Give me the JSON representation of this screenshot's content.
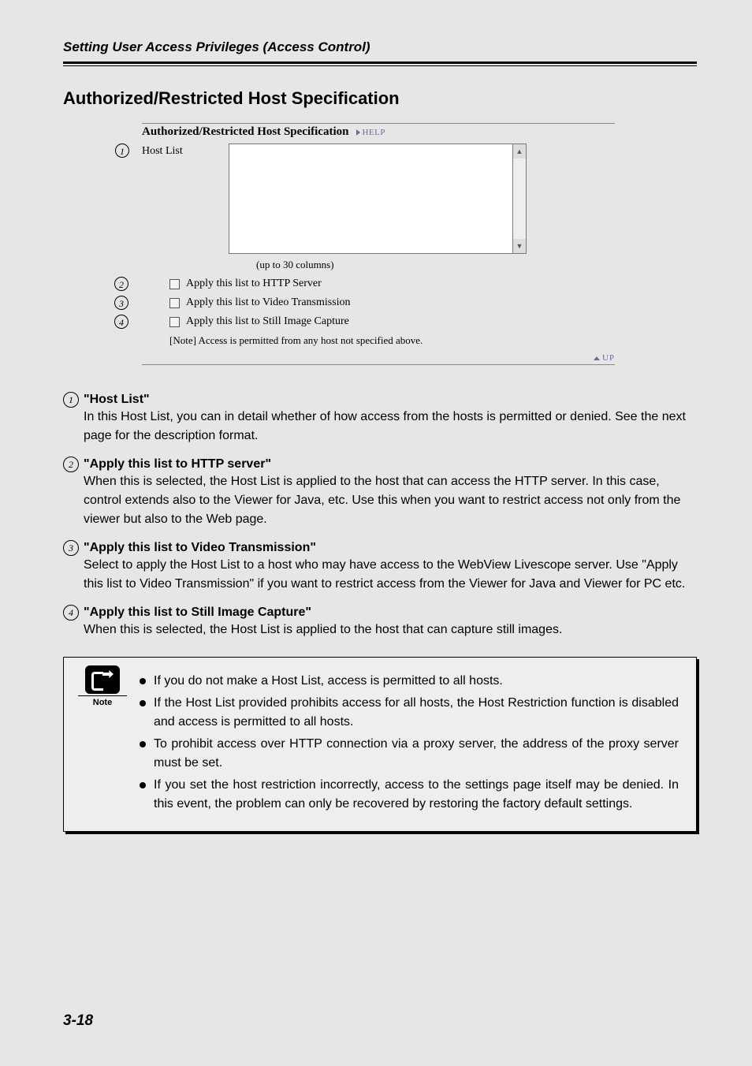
{
  "header": {
    "running_head": "Setting User Access Privileges (Access Control)"
  },
  "section_title": "Authorized/Restricted Host Specification",
  "panel": {
    "title": "Authorized/Restricted Host Specification",
    "help_label": "HELP",
    "up_label": "UP",
    "host_list_label": "Host List",
    "host_list_hint": "(up to 30 columns)",
    "host_list_value": "",
    "checkboxes": [
      {
        "label": "Apply this list to HTTP Server",
        "checked": false
      },
      {
        "label": "Apply this list to Video Transmission",
        "checked": false
      },
      {
        "label": "Apply this list to Still Image Capture",
        "checked": false
      }
    ],
    "note_inline": "[Note] Access is permitted from any host not specified above."
  },
  "definitions": [
    {
      "num": "1",
      "title": "\"Host List\"",
      "body": "In this Host List, you can in detail whether of how access from the hosts is permitted or denied. See the next page for the description format."
    },
    {
      "num": "2",
      "title": "\"Apply this list to HTTP server\"",
      "body": "When this is selected, the Host List is applied to the host that can access the HTTP server. In this case, control extends also to the Viewer for Java, etc. Use this when you want to restrict access not only from the viewer but also to the Web page."
    },
    {
      "num": "3",
      "title": "\"Apply this list to Video Transmission\"",
      "body": "Select to apply the Host List to a host who may have access to the WebView Livescope server. Use \"Apply this list to Video Transmission\" if you want to restrict access from the Viewer for Java and Viewer for PC etc."
    },
    {
      "num": "4",
      "title": "\"Apply this list to Still Image Capture\"",
      "body": "When this is selected, the Host List is applied to the host that can capture still images."
    }
  ],
  "note_box": {
    "label": "Note",
    "items": [
      "If you do not make a Host List, access is permitted to all hosts.",
      "If the Host List provided prohibits access for all hosts, the Host Restriction function is disabled and access is permitted to all hosts.",
      "To prohibit access over HTTP connection via a proxy server, the address of the proxy server must be set.",
      "If you set the host restriction incorrectly, access to the settings page itself may be denied. In this event, the problem can only be recovered by restoring the factory default settings."
    ]
  },
  "page_number": "3-18"
}
